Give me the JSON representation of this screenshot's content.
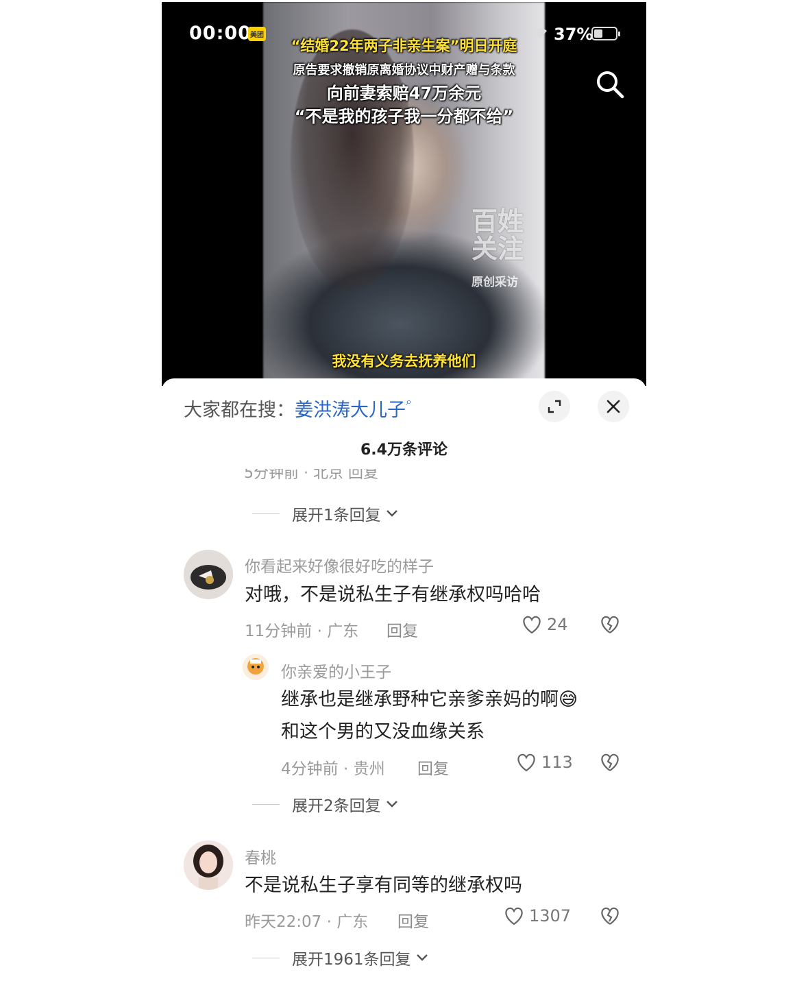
{
  "status_bar": {
    "time": "00:00",
    "badge": "美团",
    "battery": "37%"
  },
  "video": {
    "headline_1": "“结婚22年两子非亲生案”明日开庭",
    "headline_2": "原告要求撤销原离婚协议中财产赠与条款",
    "headline_3": "向前妻索赔47万余元",
    "headline_4": "“不是我的孩子我一分都不给”",
    "watermark_1": "百姓",
    "watermark_2": "关注",
    "watermark_sub": "原创采访",
    "subtitle": "我没有义务去抚养他们"
  },
  "sheet": {
    "search_prefix": "大家都在搜：",
    "search_keyword": "姜洪涛大儿子",
    "comment_count": "6.4万条评论",
    "cut_row": "5分钟前 · 北京    回复"
  },
  "threads": [
    {
      "expand": "展开1条回复"
    },
    {
      "username": "你看起来好像很好吃的样子",
      "text": "对哦，不是说私生子有继承权吗哈哈",
      "meta": "11分钟前 · 广东",
      "reply": "回复",
      "likes": "24",
      "sub": {
        "username": "你亲爱的小王子",
        "text_1": "继承也是继承野种它亲爹亲妈的啊😅",
        "text_2": "和这个男的又没血缘关系",
        "meta": "4分钟前 · 贵州",
        "reply": "回复",
        "likes": "113"
      },
      "expand": "展开2条回复"
    },
    {
      "username": "春桃",
      "text": "不是说私生子享有同等的继承权吗",
      "meta": "昨天22:07 · 广东",
      "reply": "回复",
      "likes": "1307",
      "expand": "展开1961条回复"
    }
  ]
}
